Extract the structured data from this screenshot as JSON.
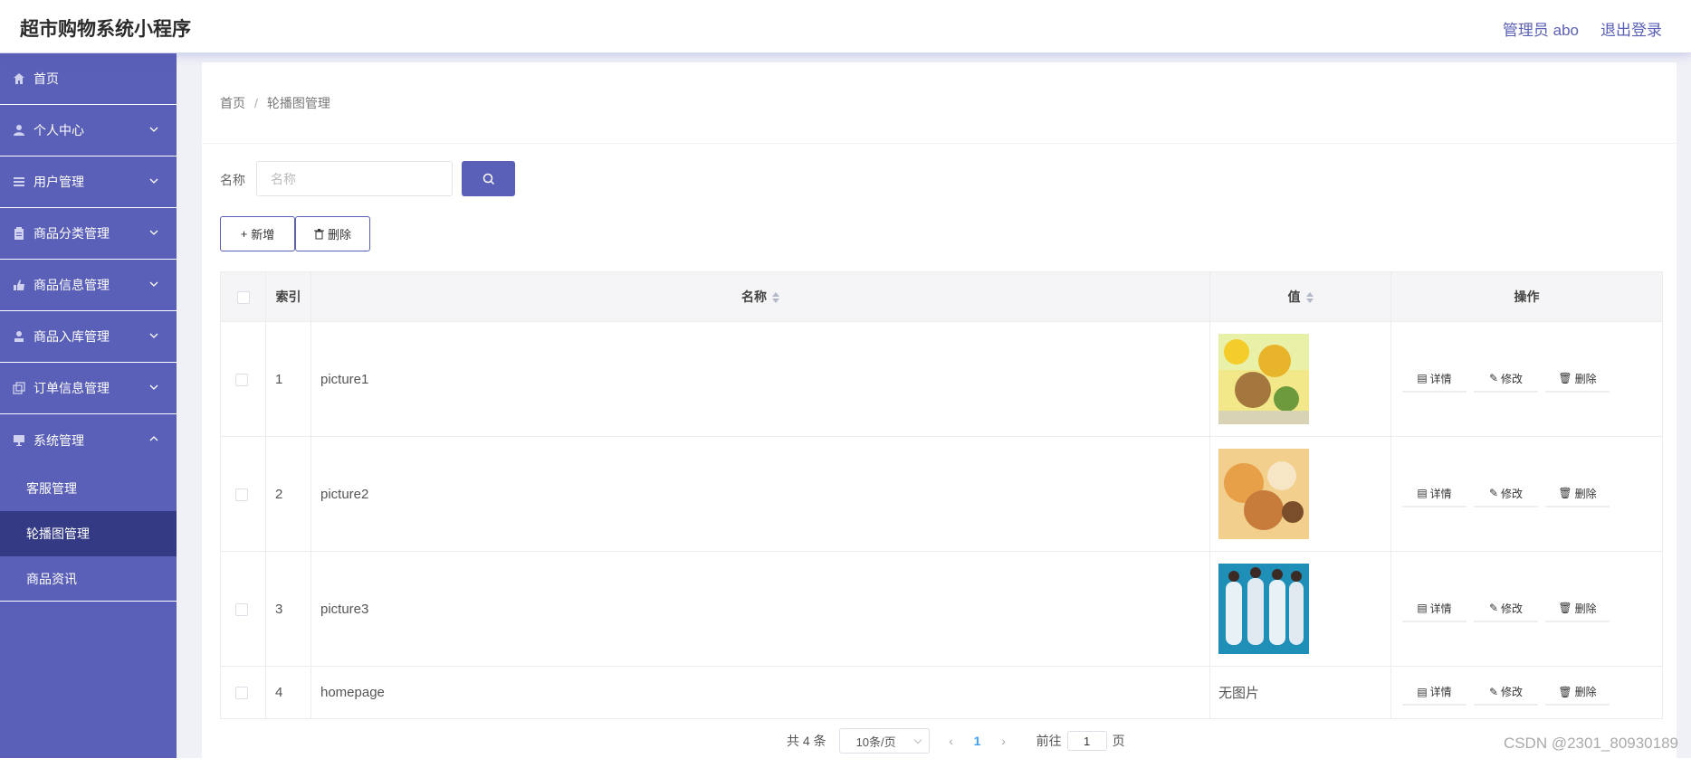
{
  "header": {
    "title": "超市购物系统小程序",
    "user": "管理员 abo",
    "logout": "退出登录"
  },
  "sidebar": {
    "items": [
      {
        "label": "首页",
        "icon": "home-icon"
      },
      {
        "label": "个人中心",
        "icon": "user-icon"
      },
      {
        "label": "用户管理",
        "icon": "list-icon"
      },
      {
        "label": "商品分类管理",
        "icon": "clipboard-icon"
      },
      {
        "label": "商品信息管理",
        "icon": "thumb-icon"
      },
      {
        "label": "商品入库管理",
        "icon": "person-stamp-icon"
      },
      {
        "label": "订单信息管理",
        "icon": "copy-icon"
      },
      {
        "label": "系统管理",
        "icon": "monitor-icon"
      }
    ],
    "subitems": [
      {
        "label": "客服管理"
      },
      {
        "label": "轮播图管理"
      },
      {
        "label": "商品资讯"
      }
    ]
  },
  "breadcrumb": {
    "home": "首页",
    "separator": "/",
    "current": "轮播图管理"
  },
  "search": {
    "label": "名称",
    "placeholder": "名称",
    "value": ""
  },
  "toolbar": {
    "add_label": "新增",
    "delete_label": "删除"
  },
  "table": {
    "headers": {
      "index": "索引",
      "name": "名称",
      "value": "值",
      "ops": "操作"
    },
    "rows": [
      {
        "index": "1",
        "name": "picture1",
        "value": "",
        "has_image": true
      },
      {
        "index": "2",
        "name": "picture2",
        "value": "",
        "has_image": true
      },
      {
        "index": "3",
        "name": "picture3",
        "value": "",
        "has_image": true
      },
      {
        "index": "4",
        "name": "homepage",
        "value": "无图片",
        "has_image": false
      }
    ],
    "actions": {
      "detail": "详情",
      "edit": "修改",
      "delete": "删除"
    }
  },
  "pagination": {
    "total": "共 4 条",
    "page_size": "10条/页",
    "current_page": "1",
    "goto_prefix": "前往",
    "goto_value": "1",
    "goto_suffix": "页"
  },
  "watermark": "CSDN @2301_80930189",
  "colors": {
    "accent": "#5a5fb7",
    "active_sub": "#353a85",
    "page_link": "#409eff"
  }
}
